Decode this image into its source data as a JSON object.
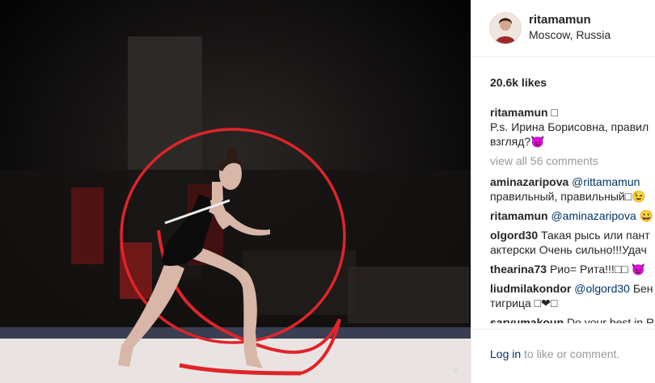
{
  "post": {
    "username": "ritamamun",
    "location": "Moscow, Russia",
    "likes": "20.6k likes",
    "watermark": "©"
  },
  "caption": {
    "user": "ritamamun",
    "badge": "□",
    "line1": "P.s. Ирина Борисовна, правил",
    "line2": "взгляд?😈"
  },
  "view_all": "view all 56 comments",
  "comments": [
    {
      "user": "aminazaripova",
      "mention": "@rittamamun",
      "text": "",
      "line2": "правильный, правильный□😉"
    },
    {
      "user": "ritamamun",
      "mention": "@aminazaripova",
      "text": "😀",
      "line2": ""
    },
    {
      "user": "olgord30",
      "mention": "",
      "text": "Такая рысь или пант",
      "line2": "актерски Очень сильно!!!Удач"
    },
    {
      "user": "thearina73",
      "mention": "",
      "text": "Рио= Рита!!!□□ 😈",
      "line2": ""
    },
    {
      "user": "liudmilakondor",
      "mention": "@olgord30",
      "text": "Бен",
      "line2": "тигрица □❤□"
    },
    {
      "user": "sarvumakoup",
      "mention": "",
      "text": "Do your best in R",
      "line2": ""
    }
  ],
  "footer": {
    "login": "Log in",
    "rest": " to like or comment."
  },
  "colors": {
    "link": "#003569",
    "muted": "#999999",
    "ribbon": "#e0242a"
  }
}
